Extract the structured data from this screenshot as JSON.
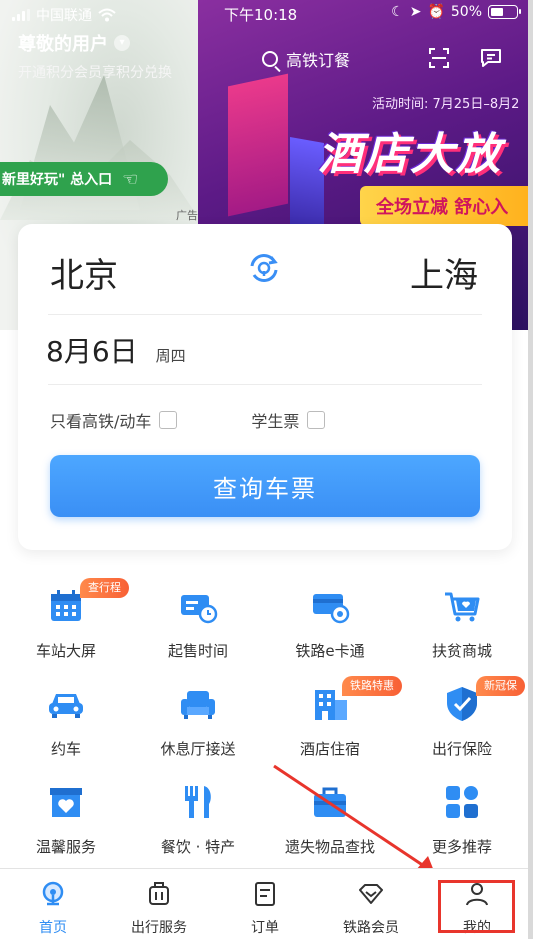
{
  "status_bar": {
    "carrier": "中国联通",
    "time": "下午10:18",
    "battery": "50%",
    "battery_level": 0.5
  },
  "header": {
    "user_name": "尊敬的用户",
    "user_sub": "开通积分会员享积分兑换",
    "search_placeholder": "高铁订餐",
    "icons": [
      "scan-icon",
      "message-icon"
    ]
  },
  "banner": {
    "promo_date": "活动时间: 7月25日–8月2",
    "promo_title": "酒店大放",
    "promo_slogan": "全场立减  舒心入",
    "entry_label": "新里好玩\" 总入口",
    "ad_tag": "广告"
  },
  "booking": {
    "from_city": "北京",
    "to_city": "上海",
    "date": "8月6日",
    "weekday": "周四",
    "option_gaotie": "只看高铁/动车",
    "option_student": "学生票",
    "query_button": "查询车票"
  },
  "services": [
    [
      {
        "label": "车站大屏",
        "icon": "calendar-icon",
        "badge": "查行程"
      },
      {
        "label": "起售时间",
        "icon": "ticket-clock-icon",
        "badge": ""
      },
      {
        "label": "铁路e卡通",
        "icon": "ecard-icon",
        "badge": ""
      },
      {
        "label": "扶贫商城",
        "icon": "cart-icon",
        "badge": ""
      }
    ],
    [
      {
        "label": "约车",
        "icon": "car-icon",
        "badge": ""
      },
      {
        "label": "休息厅接送",
        "icon": "sofa-icon",
        "badge": ""
      },
      {
        "label": "酒店住宿",
        "icon": "hotel-icon",
        "badge": "铁路特惠"
      },
      {
        "label": "出行保险",
        "icon": "shield-icon",
        "badge": "新冠保"
      }
    ],
    [
      {
        "label": "温馨服务",
        "icon": "heart-box-icon",
        "badge": ""
      },
      {
        "label": "餐饮 · 特产",
        "icon": "dining-icon",
        "badge": ""
      },
      {
        "label": "遗失物品查找",
        "icon": "briefcase-icon",
        "badge": ""
      },
      {
        "label": "更多推荐",
        "icon": "grid-icon",
        "badge": ""
      }
    ]
  ],
  "tabbar": {
    "tabs": [
      {
        "label": "首页",
        "icon": "home-rail-icon",
        "active": true
      },
      {
        "label": "出行服务",
        "icon": "luggage-icon",
        "active": false
      },
      {
        "label": "订单",
        "icon": "order-icon",
        "active": false
      },
      {
        "label": "铁路会员",
        "icon": "diamond-icon",
        "active": false
      },
      {
        "label": "我的",
        "icon": "user-icon",
        "active": false
      }
    ]
  },
  "colors": {
    "accent": "#3a8ff5",
    "badge": "#f86035",
    "annotation": "#e8352c"
  }
}
